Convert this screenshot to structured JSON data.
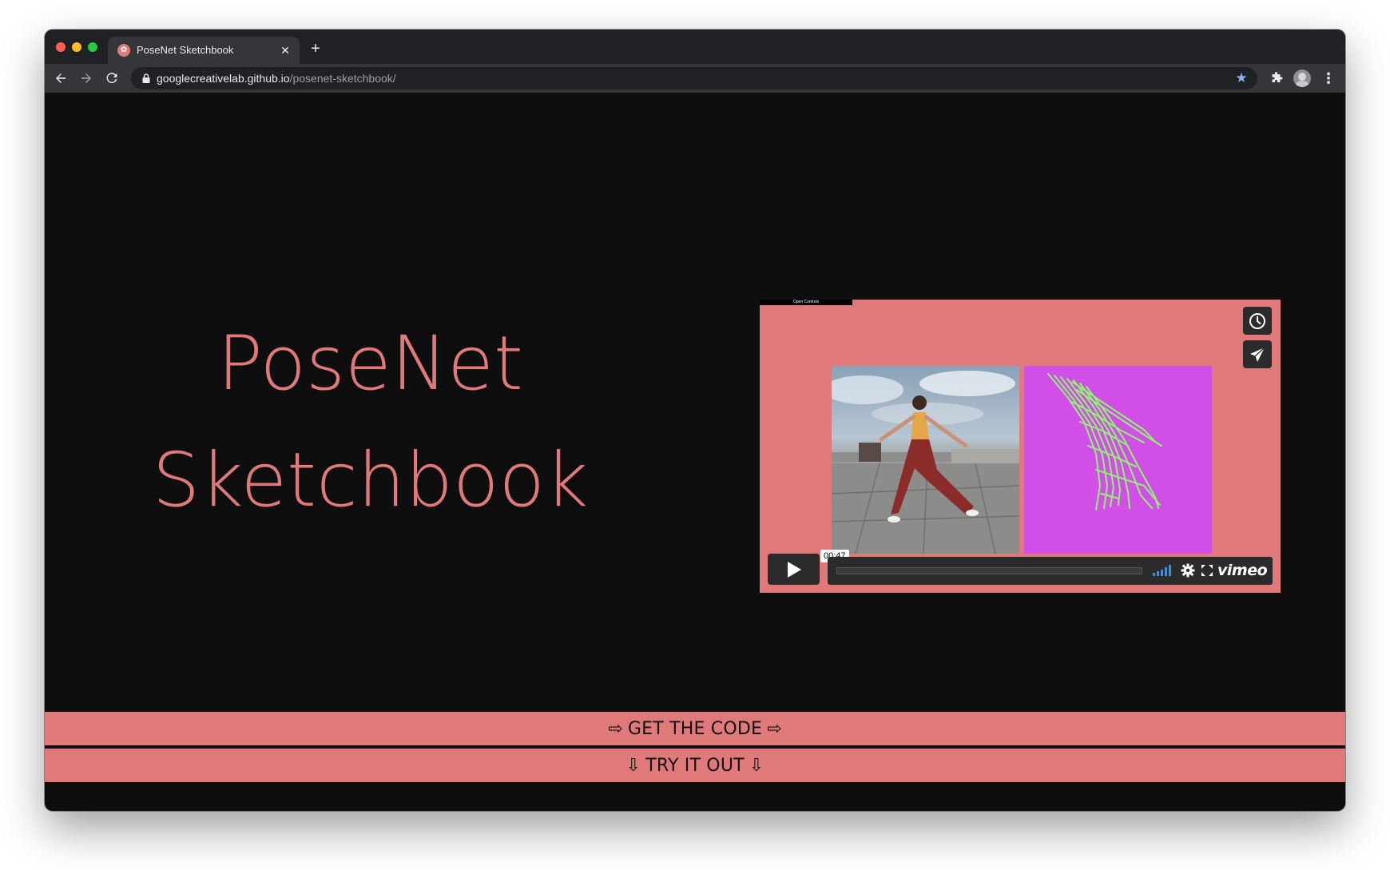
{
  "browser": {
    "tab_title": "PoseNet Sketchbook",
    "tab_close": "✕",
    "new_tab": "+",
    "url_host": "googlecreativelab.github.io",
    "url_path": "/posenet-sketchbook/",
    "icons": [
      "back-arrow-icon",
      "forward-arrow-icon",
      "reload-icon",
      "lock-icon",
      "star-icon",
      "puzzle-icon",
      "kebab-menu-icon"
    ]
  },
  "hero": {
    "line1": "PoseNet",
    "line2": "Sketchbook",
    "color": "#e07a7a"
  },
  "video": {
    "open_controls": "Open Controls",
    "timestamp": "00:47",
    "brand": "vimeo",
    "bg_color": "#e07a7a",
    "right_panel_color": "#d14fe7",
    "skeleton_color": "#8ef56e"
  },
  "cta": {
    "get_code": "GET THE CODE",
    "get_code_arrow": "⇨",
    "try_it": "TRY IT OUT",
    "try_it_arrow": "⇩",
    "color": "#e07a7a"
  }
}
